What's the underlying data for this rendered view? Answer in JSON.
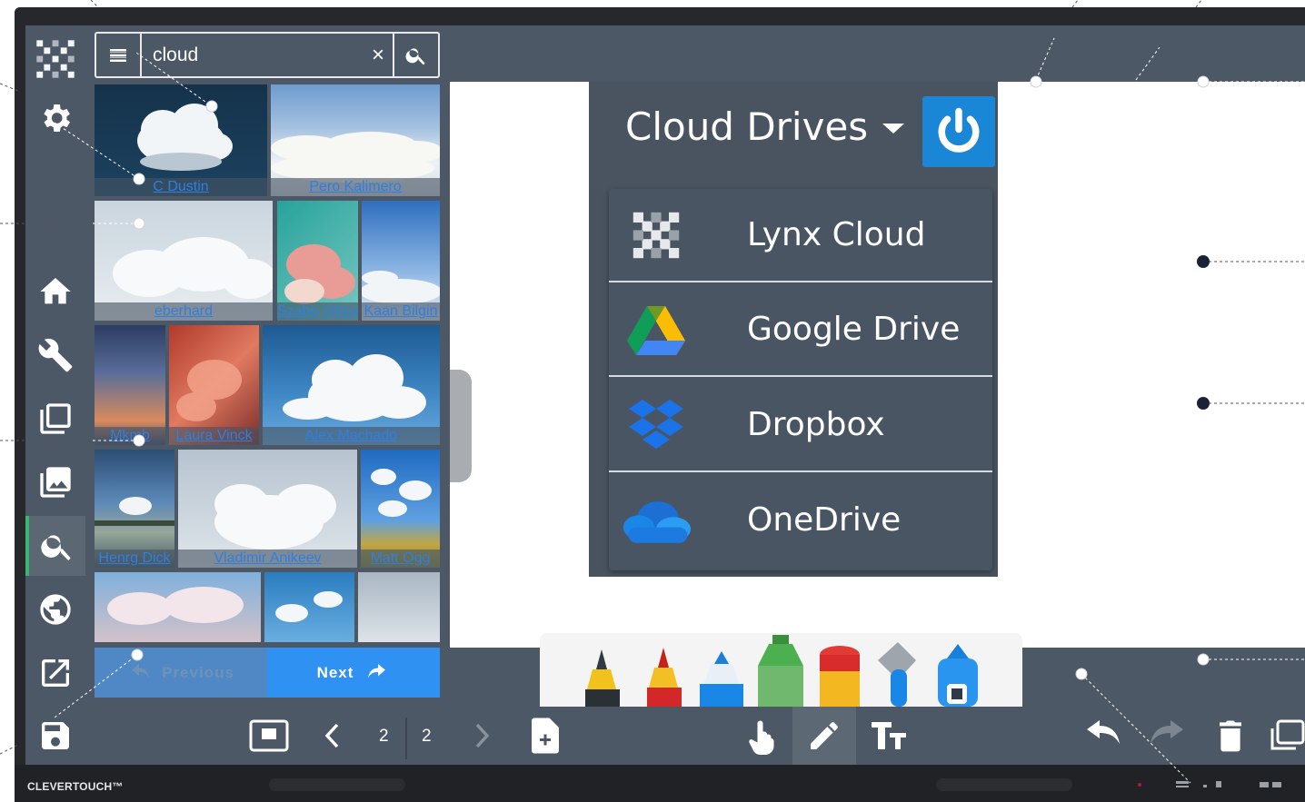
{
  "search": {
    "value": "cloud",
    "clear_glyph": "×"
  },
  "image_results": [
    {
      "credit": "C Dustin",
      "palette": "#143046"
    },
    {
      "credit": "Pero Kalimero",
      "palette": "#8fb2d6"
    },
    {
      "credit": "eberhard",
      "palette": "#c9d5de"
    },
    {
      "credit": "Szabo Viktor",
      "palette": "#3fa7a3"
    },
    {
      "credit": "Kaan Bilgin",
      "palette": "#3e7cc5"
    },
    {
      "credit": "Mkmb",
      "palette": "#3a4f77"
    },
    {
      "credit": "Laura Vinck",
      "palette": "#c65b3f"
    },
    {
      "credit": "Alex Machado",
      "palette": "#27689f"
    },
    {
      "credit": "Henrg Dick",
      "palette": "#2f5479"
    },
    {
      "credit": "Vladimir Anikeev",
      "palette": "#c7d0d8"
    },
    {
      "credit": "Matt Ogg",
      "palette": "#2e7bc6"
    },
    {
      "credit": "",
      "palette": "#c9b8c2"
    },
    {
      "credit": "",
      "palette": "#3f8ac0"
    },
    {
      "credit": "",
      "palette": "#c3ccd4"
    }
  ],
  "pagination": {
    "previous_label": "Previous",
    "next_label": "Next"
  },
  "cloud_drives": {
    "title": "Cloud Drives",
    "items": [
      {
        "label": "Lynx Cloud",
        "icon": "lynx-logo-icon"
      },
      {
        "label": "Google Drive",
        "icon": "google-drive-icon"
      },
      {
        "label": "Dropbox",
        "icon": "dropbox-icon"
      },
      {
        "label": "OneDrive",
        "icon": "onedrive-icon"
      }
    ]
  },
  "toolbar": {
    "current_page": "2",
    "total_pages": "2"
  },
  "bezel": {
    "brand": "CLEVERTOUCH™"
  },
  "colors": {
    "panel": "#4d5866",
    "accent_blue": "#2f92f2",
    "active_indicator": "#39b574",
    "power_button": "#1a86d6"
  }
}
